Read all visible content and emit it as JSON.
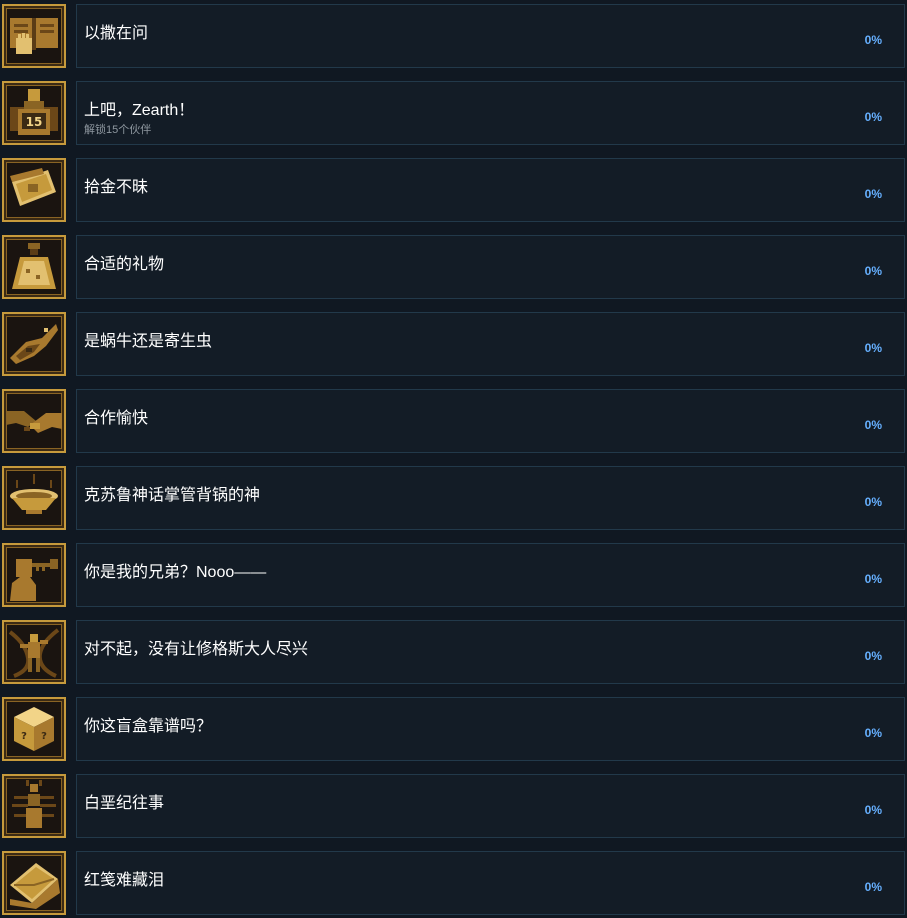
{
  "achievements": [
    {
      "title": "以撒在问",
      "desc": "",
      "percent": "0%",
      "icon": "open-book-hand-icon"
    },
    {
      "title": "上吧，Zearth！",
      "desc": "解锁15个伙伴",
      "percent": "0%",
      "icon": "companions-15-icon"
    },
    {
      "title": "拾金不昧",
      "desc": "",
      "percent": "0%",
      "icon": "gold-wallet-icon"
    },
    {
      "title": "合适的礼物",
      "desc": "",
      "percent": "0%",
      "icon": "gift-sack-icon"
    },
    {
      "title": "是蜗牛还是寄生虫",
      "desc": "",
      "percent": "0%",
      "icon": "snail-parasite-icon"
    },
    {
      "title": "合作愉快",
      "desc": "",
      "percent": "0%",
      "icon": "handshake-icon"
    },
    {
      "title": "克苏鲁神话掌管背锅的神",
      "desc": "",
      "percent": "0%",
      "icon": "golden-bowl-icon"
    },
    {
      "title": "你是我的兄弟？Nooo——",
      "desc": "",
      "percent": "0%",
      "icon": "silhouette-key-icon"
    },
    {
      "title": "对不起，没有让修格斯大人尽兴",
      "desc": "",
      "percent": "0%",
      "icon": "tentacle-figure-icon"
    },
    {
      "title": "你这盲盒靠谱吗？",
      "desc": "",
      "percent": "0%",
      "icon": "mystery-box-icon"
    },
    {
      "title": "白垩纪往事",
      "desc": "",
      "percent": "0%",
      "icon": "ant-fossil-icon"
    },
    {
      "title": "红笺难藏泪",
      "desc": "",
      "percent": "0%",
      "icon": "golden-letter-icon"
    }
  ],
  "colors": {
    "background": "#101822",
    "card": "#131c26",
    "card_border": "#22394a",
    "title": "#ffffff",
    "description": "#8f98a0",
    "percent": "#66b0ff",
    "icon_gold": "#c69a3c"
  }
}
